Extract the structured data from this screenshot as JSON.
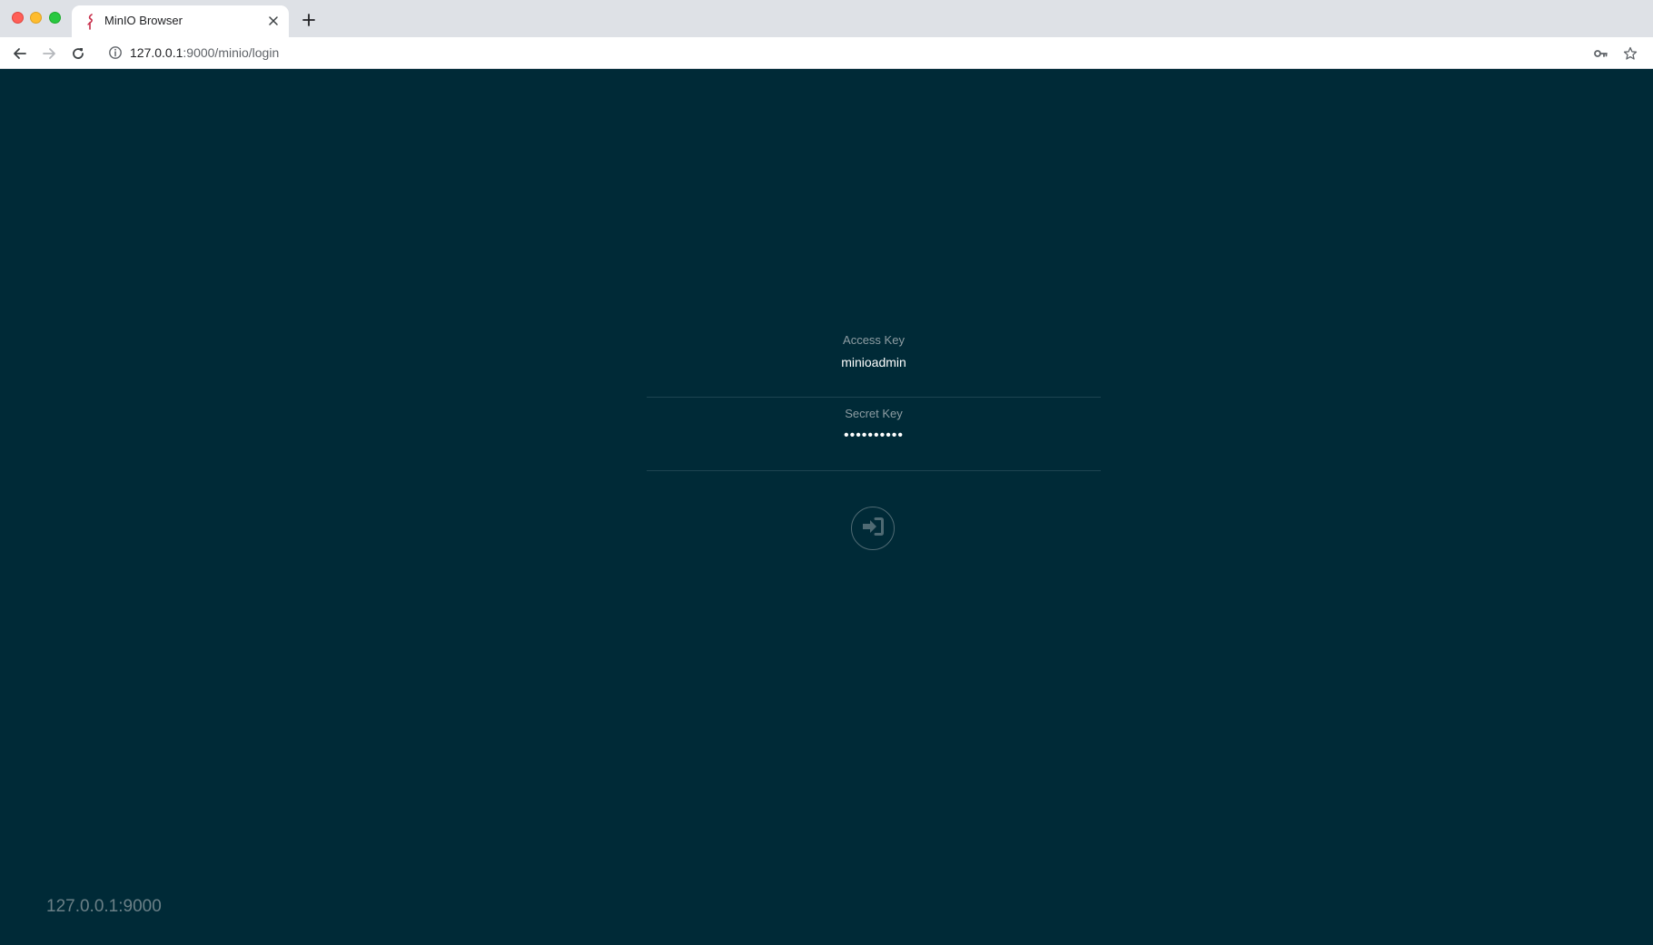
{
  "browser": {
    "tab": {
      "title": "MinIO Browser"
    },
    "address_bar": {
      "host": "127.0.0.1",
      "rest": ":9000/minio/login"
    }
  },
  "login": {
    "access_key": {
      "label": "Access Key",
      "value": "minioadmin"
    },
    "secret_key": {
      "label": "Secret Key",
      "value": "••••••••••"
    },
    "submit_icon": "sign-in-icon"
  },
  "footer": {
    "host": "127.0.0.1:9000"
  },
  "colors": {
    "page_background": "#002a37",
    "label": "#8e9da3",
    "divider": "#1e4451",
    "favicon": "#c72c48"
  }
}
